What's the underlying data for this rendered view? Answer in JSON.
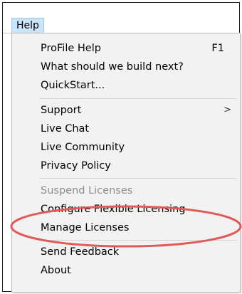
{
  "menubar": {
    "help_label": "Help"
  },
  "menu": {
    "items": [
      {
        "label": "ProFile Help",
        "shortcut": "F1"
      },
      {
        "label": "What should we build next?"
      },
      {
        "label": "QuickStart..."
      },
      {
        "label": "Support",
        "submenu_arrow": ">"
      },
      {
        "label": "Live Chat"
      },
      {
        "label": "Live Community"
      },
      {
        "label": "Privacy Policy"
      },
      {
        "label": "Suspend Licenses",
        "disabled": true
      },
      {
        "label": "Configure Flexible Licensing"
      },
      {
        "label": "Manage Licenses"
      },
      {
        "label": "Send Feedback"
      },
      {
        "label": "About"
      }
    ]
  },
  "annotation": {
    "ellipse_color": "#e05a5a"
  }
}
